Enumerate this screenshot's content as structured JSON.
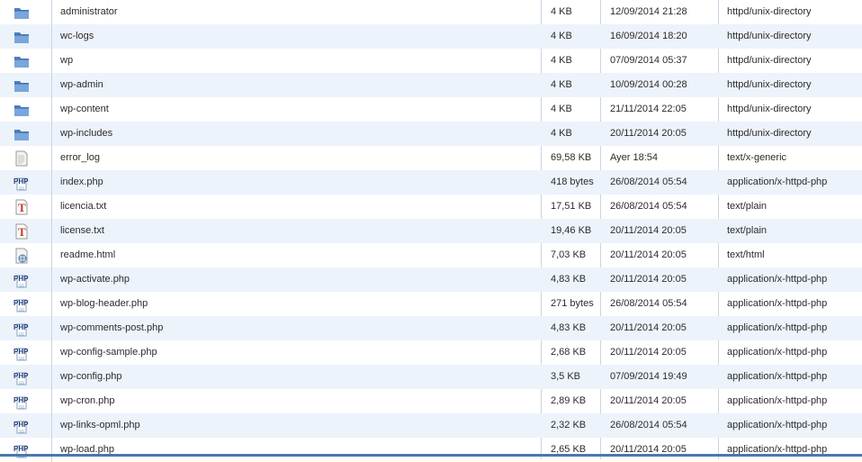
{
  "files": [
    {
      "icon": "folder-icon",
      "name": "administrator",
      "size": "4 KB",
      "date": "12/09/2014 21:28",
      "type": "httpd/unix-directory"
    },
    {
      "icon": "folder-icon",
      "name": "wc-logs",
      "size": "4 KB",
      "date": "16/09/2014 18:20",
      "type": "httpd/unix-directory"
    },
    {
      "icon": "folder-icon",
      "name": "wp",
      "size": "4 KB",
      "date": "07/09/2014 05:37",
      "type": "httpd/unix-directory"
    },
    {
      "icon": "folder-icon",
      "name": "wp-admin",
      "size": "4 KB",
      "date": "10/09/2014 00:28",
      "type": "httpd/unix-directory"
    },
    {
      "icon": "folder-icon",
      "name": "wp-content",
      "size": "4 KB",
      "date": "21/11/2014 22:05",
      "type": "httpd/unix-directory"
    },
    {
      "icon": "folder-icon",
      "name": "wp-includes",
      "size": "4 KB",
      "date": "20/11/2014 20:05",
      "type": "httpd/unix-directory"
    },
    {
      "icon": "generic-file-icon",
      "name": "error_log",
      "size": "69,58 KB",
      "date": "Ayer 18:54",
      "type": "text/x-generic"
    },
    {
      "icon": "php-file-icon",
      "name": "index.php",
      "size": "418 bytes",
      "date": "26/08/2014 05:54",
      "type": "application/x-httpd-php"
    },
    {
      "icon": "text-file-icon",
      "name": "licencia.txt",
      "size": "17,51 KB",
      "date": "26/08/2014 05:54",
      "type": "text/plain"
    },
    {
      "icon": "text-file-icon",
      "name": "license.txt",
      "size": "19,46 KB",
      "date": "20/11/2014 20:05",
      "type": "text/plain"
    },
    {
      "icon": "html-file-icon",
      "name": "readme.html",
      "size": "7,03 KB",
      "date": "20/11/2014 20:05",
      "type": "text/html"
    },
    {
      "icon": "php-file-icon",
      "name": "wp-activate.php",
      "size": "4,83 KB",
      "date": "20/11/2014 20:05",
      "type": "application/x-httpd-php"
    },
    {
      "icon": "php-file-icon",
      "name": "wp-blog-header.php",
      "size": "271 bytes",
      "date": "26/08/2014 05:54",
      "type": "application/x-httpd-php"
    },
    {
      "icon": "php-file-icon",
      "name": "wp-comments-post.php",
      "size": "4,83 KB",
      "date": "20/11/2014 20:05",
      "type": "application/x-httpd-php"
    },
    {
      "icon": "php-file-icon",
      "name": "wp-config-sample.php",
      "size": "2,68 KB",
      "date": "20/11/2014 20:05",
      "type": "application/x-httpd-php"
    },
    {
      "icon": "php-file-icon",
      "name": "wp-config.php",
      "size": "3,5 KB",
      "date": "07/09/2014 19:49",
      "type": "application/x-httpd-php"
    },
    {
      "icon": "php-file-icon",
      "name": "wp-cron.php",
      "size": "2,89 KB",
      "date": "20/11/2014 20:05",
      "type": "application/x-httpd-php"
    },
    {
      "icon": "php-file-icon",
      "name": "wp-links-opml.php",
      "size": "2,32 KB",
      "date": "26/08/2014 05:54",
      "type": "application/x-httpd-php"
    },
    {
      "icon": "php-file-icon",
      "name": "wp-load.php",
      "size": "2,65 KB",
      "date": "20/11/2014 20:05",
      "type": "application/x-httpd-php"
    }
  ],
  "colors": {
    "row_alt": "#edf3fb",
    "folder": "#5f8fcb",
    "php_text": "#1f3f7a",
    "txt_icon": "#c0392b",
    "accent_bar": "#4a79a8"
  }
}
